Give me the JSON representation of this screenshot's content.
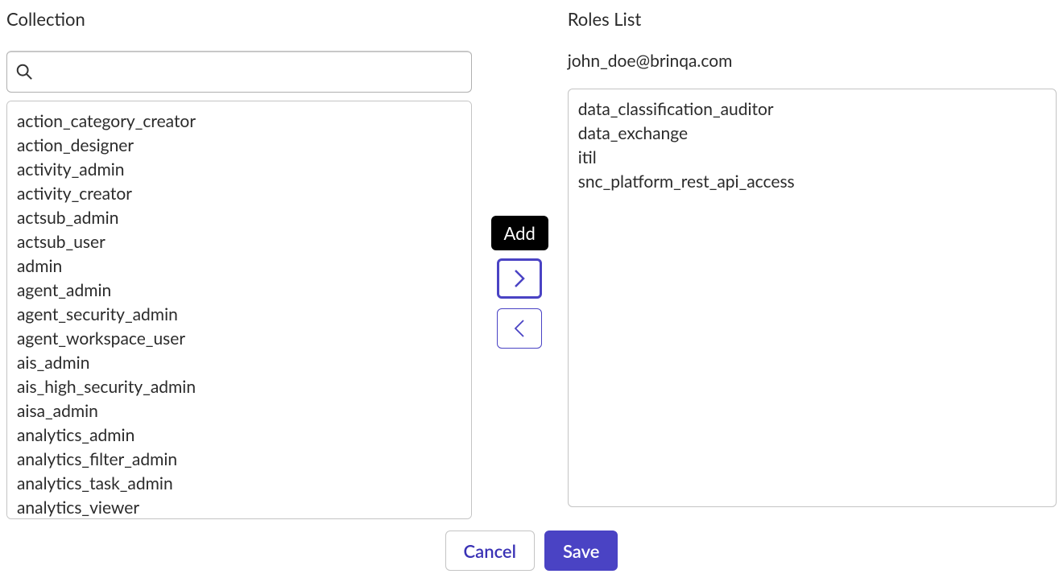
{
  "collection": {
    "title": "Collection",
    "searchPlaceholder": "",
    "items": [
      "action_category_creator",
      "action_designer",
      "activity_admin",
      "activity_creator",
      "actsub_admin",
      "actsub_user",
      "admin",
      "agent_admin",
      "agent_security_admin",
      "agent_workspace_user",
      "ais_admin",
      "ais_high_security_admin",
      "aisa_admin",
      "analytics_admin",
      "analytics_filter_admin",
      "analytics_task_admin",
      "analytics_viewer"
    ]
  },
  "rolesList": {
    "title": "Roles List",
    "userEmail": "john_doe@brinqa.com",
    "items": [
      "data_classification_auditor",
      "data_exchange",
      "itil",
      "snc_platform_rest_api_access"
    ]
  },
  "controls": {
    "addTooltip": "Add"
  },
  "footer": {
    "cancel": "Cancel",
    "save": "Save"
  }
}
